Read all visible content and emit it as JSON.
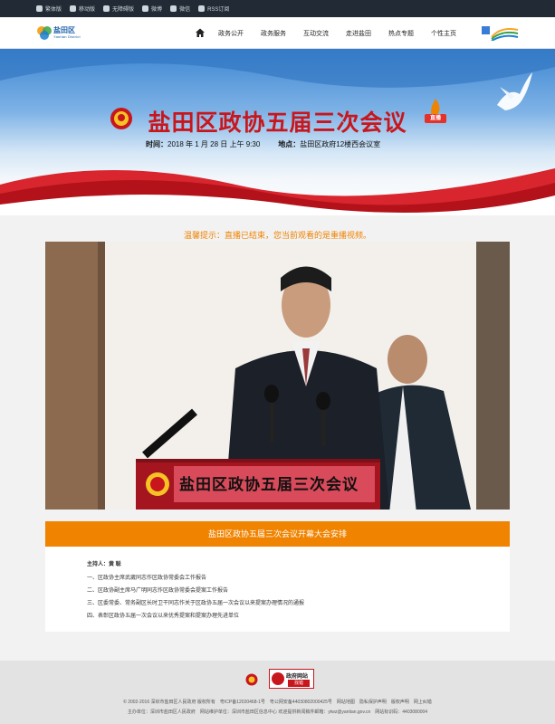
{
  "topbar": {
    "links": [
      {
        "icon": "traditional-icon",
        "label": "繁体版"
      },
      {
        "icon": "mobile-icon",
        "label": "移动版"
      },
      {
        "icon": "accessibility-icon",
        "label": "无障碍版"
      },
      {
        "icon": "weibo-icon",
        "label": "微博"
      },
      {
        "icon": "wechat-icon",
        "label": "微信"
      },
      {
        "icon": "rss-icon",
        "label": "RSS订阅"
      }
    ]
  },
  "nav": {
    "logo_title": "盐田区",
    "logo_subtitle": "Yantian District",
    "items": [
      "政务公开",
      "政务服务",
      "互动交流",
      "走进盐田",
      "热点专题",
      "个性主页"
    ]
  },
  "banner": {
    "title": "盐田区政协五届三次会议",
    "live_badge": "直播",
    "time_label": "时间：",
    "time_value": "2018 年 1 月 28 日 上午 9:30",
    "place_label": "地点：",
    "place_value": "盐田区政府12楼西会议室"
  },
  "notice": "温馨提示：直播已结束，您当前观看的是重播视频。",
  "video": {
    "podium_text": "盐田区政协五届三次会议"
  },
  "agenda": {
    "title": "盐田区政协五届三次会议开幕大会安排",
    "host": "主持人：黄 聪",
    "items": [
      "一、区政协主席武崴同志作区政协常委会工作报告",
      "二、区政协副主席马广明同志作区政协常委会提案工作报告",
      "三、区委常委、常务副区长时卫干同志作关于区政协五届一次会议以来提案办理情况的通报",
      "四、表彰区政协五届一次会议以来优秀提案和提案办理先进单位"
    ]
  },
  "footer": {
    "badge_line1": "政府网站",
    "badge_line2": "找错",
    "line1": "© 2002-2016 深圳市盐田区人民政府 版权所有　粤ICP备12020468-1号　粤公网安备44030802000425号　网站地图　隐私保护声明　版权声明　网上纠错",
    "line2": "主办单位：深圳市盐田区人民政府　网站维护单位：深圳市盐田区信息中心 欢迎提供新闻稿件邮箱：ytwz@yantian.gov.cn　网站标识码：4403080004"
  },
  "colors": {
    "accent_orange": "#f08300",
    "title_red": "#c8161d",
    "topbar": "#222b35"
  }
}
